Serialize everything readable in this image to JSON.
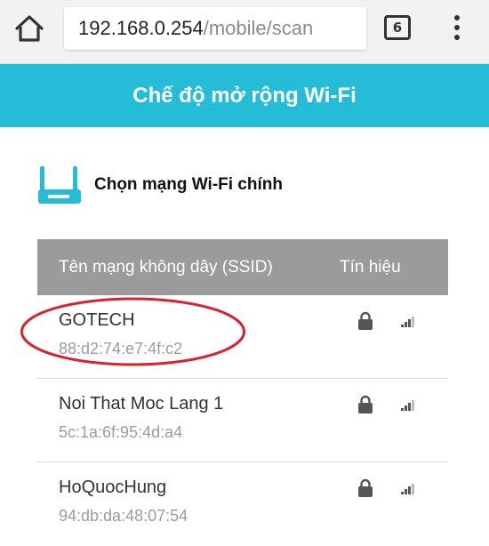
{
  "browser": {
    "url_host": "192.168.0.254",
    "url_path": "/mobile/scan",
    "tab_count": "6",
    "icons": [
      "home-icon",
      "tabs-icon",
      "overflow-menu-icon"
    ]
  },
  "header": {
    "title": "Chế độ mở rộng Wi-Fi",
    "color": "#25bcd8"
  },
  "section": {
    "title": "Chọn mạng Wi-Fi chính",
    "icon": "router-icon",
    "icon_color": "#25bcd8"
  },
  "table": {
    "columns": [
      "Tên mạng không dây (SSID)",
      "Tín hiệu"
    ],
    "header_color": "#9b9b9b",
    "rows": [
      {
        "ssid": "GOTECH",
        "mac": "88:d2:74:e7:4f:c2",
        "secured": true,
        "highlighted": true
      },
      {
        "ssid": "Noi That Moc Lang 1",
        "mac": "5c:1a:6f:95:4d:a4",
        "secured": true,
        "highlighted": false
      },
      {
        "ssid": "HoQuocHung",
        "mac": "94:db:da:48:07:54",
        "secured": true,
        "highlighted": false
      }
    ]
  },
  "annotation": {
    "color": "#d9232a"
  }
}
